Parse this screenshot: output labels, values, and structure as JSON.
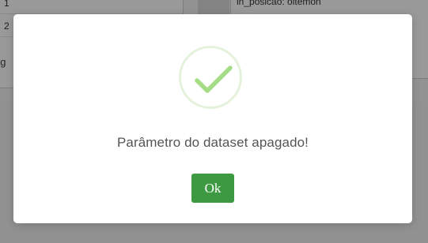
{
  "background": {
    "left_rows": [
      "1",
      "2"
    ],
    "paging_text": "ag",
    "right_text": "in_posicao: oitemon"
  },
  "dialog": {
    "icon": "check-circle-icon",
    "message": "Parâmetro do dataset apagado!",
    "ok_label": "Ok",
    "colors": {
      "check": "#a5dc86",
      "ring": "#e4f2dc",
      "button": "#3d9a43"
    }
  }
}
